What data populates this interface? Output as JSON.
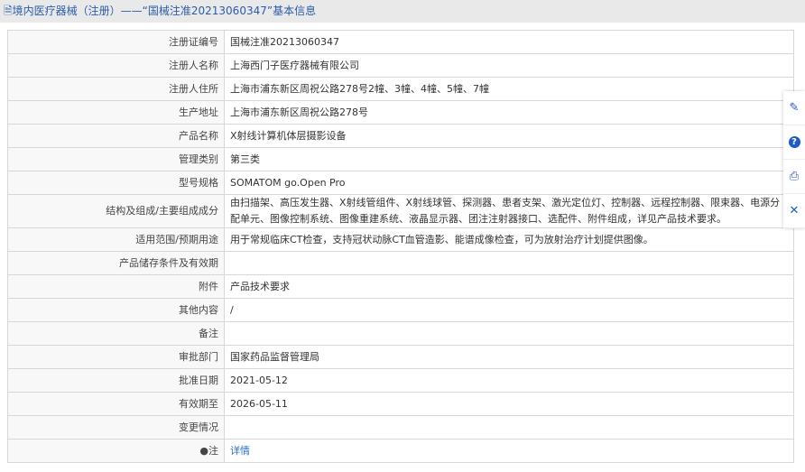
{
  "header": {
    "title": "境内医疗器械（注册）——“国械注准20213060347”基本信息"
  },
  "rows": [
    {
      "label": "注册证编号",
      "value": "国械注准20213060347"
    },
    {
      "label": "注册人名称",
      "value": "上海西门子医疗器械有限公司"
    },
    {
      "label": "注册人住所",
      "value": "上海市浦东新区周祝公路278号2幢、3幢、4幢、5幢、7幢"
    },
    {
      "label": "生产地址",
      "value": "上海市浦东新区周祝公路278号"
    },
    {
      "label": "产品名称",
      "value": "X射线计算机体层摄影设备"
    },
    {
      "label": "管理类别",
      "value": "第三类"
    },
    {
      "label": "型号规格",
      "value": "SOMATOM go.Open Pro"
    },
    {
      "label": "结构及组成/主要组成成分",
      "value": "由扫描架、高压发生器、X射线管组件、X射线球管、探测器、患者支架、激光定位灯、控制器、远程控制器、限束器、电源分配单元、图像控制系统、图像重建系统、液晶显示器、团注注射器接口、选配件、附件组成，详见产品技术要求。"
    },
    {
      "label": "适用范围/预期用途",
      "value": "用于常规临床CT检查，支持冠状动脉CT血管造影、能谱成像检查，可为放射治疗计划提供图像。"
    },
    {
      "label": "产品储存条件及有效期",
      "value": ""
    },
    {
      "label": "附件",
      "value": "产品技术要求"
    },
    {
      "label": "其他内容",
      "value": "/"
    },
    {
      "label": "备注",
      "value": ""
    },
    {
      "label": "审批部门",
      "value": "国家药品监督管理局"
    },
    {
      "label": "批准日期",
      "value": "2021-05-12"
    },
    {
      "label": "有效期至",
      "value": "2026-05-11"
    },
    {
      "label": "变更情况",
      "value": ""
    }
  ],
  "note": {
    "label": "注",
    "link": "详情"
  }
}
